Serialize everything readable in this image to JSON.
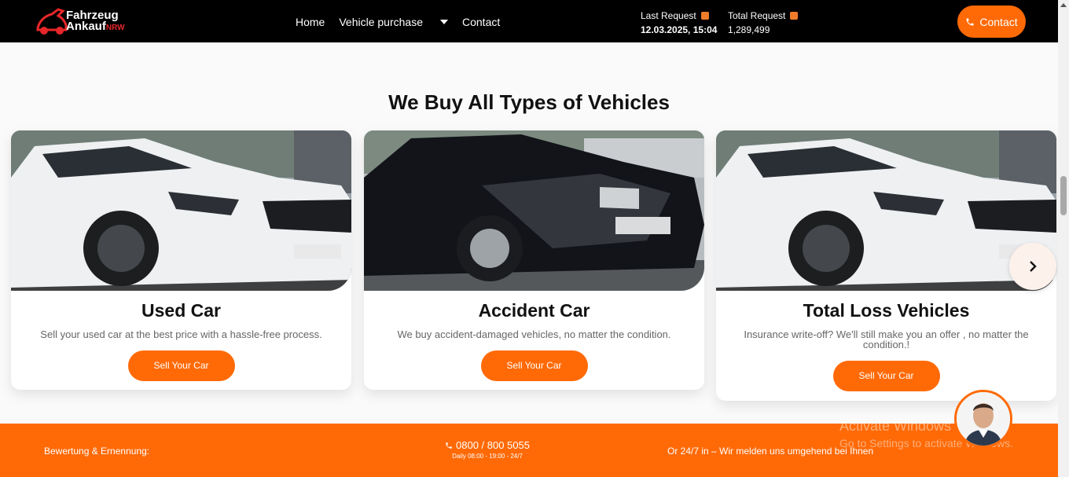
{
  "header": {
    "logo_line1": "Fahrzeug",
    "logo_line2": "Ankauf",
    "logo_suffix": "NRW",
    "nav": {
      "home": "Home",
      "vehicle_purchase": "Vehicle purchase",
      "contact": "Contact"
    },
    "last_request": {
      "label": "Last Request",
      "value": "12.03.2025, 15:04"
    },
    "total_request": {
      "label": "Total Request",
      "value": "1,289,499"
    },
    "contact_button": "Contact"
  },
  "section": {
    "title": "We Buy All Types of Vehicles",
    "cards": [
      {
        "title": "Used Car",
        "description": "Sell your used car at the best price with a hassle-free process.",
        "button": "Sell Your Car"
      },
      {
        "title": "Accident Car",
        "description": "We buy accident-damaged vehicles, no matter the condition.",
        "button": "Sell Your Car"
      },
      {
        "title": "Total Loss Vehicles",
        "description": "Insurance write-off? We'll still make you an offer , no matter the condition.!",
        "button": "Sell Your Car"
      }
    ]
  },
  "footer": {
    "left": "Bewertung & Ernennung:",
    "phone": "0800 / 800 5055",
    "hours": "Daily 08:00 - 19:00 - 24/7",
    "right": "Or 24/7 in – Wir melden uns umgehend bei Ihnen"
  },
  "watermark": {
    "title": "Activate Windows",
    "subtitle": "Go to Settings to activate Windows."
  },
  "colors": {
    "accent": "#ff6a07",
    "header_bg": "#000000",
    "logo_red": "#e8262a"
  },
  "icons": [
    "car-logo-icon",
    "caret-down-icon",
    "clock-icon",
    "chart-icon",
    "phone-icon",
    "chevron-right-icon"
  ]
}
